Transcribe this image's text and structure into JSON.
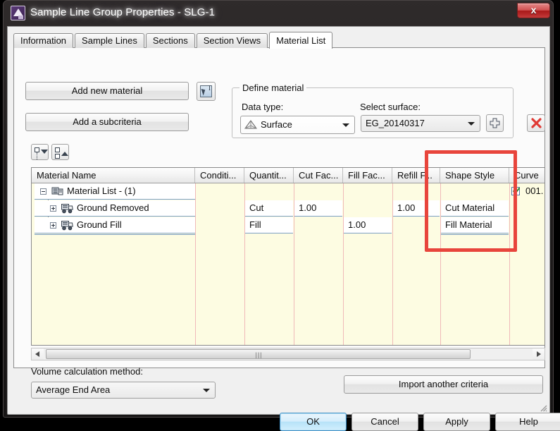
{
  "window": {
    "title": "Sample Line Group Properties - SLG-1",
    "app_icon": "civil3d-app-icon",
    "close_label": "x"
  },
  "tabs": [
    {
      "label": "Information",
      "active": false
    },
    {
      "label": "Sample Lines",
      "active": false
    },
    {
      "label": "Sections",
      "active": false
    },
    {
      "label": "Section Views",
      "active": false
    },
    {
      "label": "Material List",
      "active": true
    }
  ],
  "toolbar": {
    "add_new_material": "Add new material",
    "add_a_subcriteria": "Add a subcriteria",
    "pick_icon": "pick-on-screen-icon",
    "tree_expand_icon": "expand-all-icon",
    "tree_collapse_icon": "collapse-all-icon"
  },
  "define_material": {
    "legend": "Define material",
    "data_type_label": "Data type:",
    "data_type_value": "Surface",
    "data_type_icon": "surface-icon",
    "select_surface_label": "Select surface:",
    "select_surface_value": "EG_20140317",
    "add_icon": "plus-icon",
    "delete_icon": "red-x-icon"
  },
  "grid": {
    "columns": [
      "Material Name",
      "Conditi...",
      "Quantit...",
      "Cut Fac...",
      "Fill Fac...",
      "Refill F...",
      "Shape Style",
      "Curve"
    ],
    "rows": [
      {
        "name": "Material List - (1)",
        "indent": 0,
        "toggle": "minus",
        "icon": "material-list-icon",
        "condition": "",
        "quantity": "",
        "cut_factor": "",
        "fill_factor": "",
        "refill_factor": "",
        "shape_style": "",
        "curve_checked": true,
        "curve": "001."
      },
      {
        "name": "Ground Removed",
        "indent": 1,
        "toggle": "plus",
        "icon": "material-truck-icon",
        "condition": "",
        "quantity": "Cut",
        "cut_factor": "1.00",
        "fill_factor": "",
        "refill_factor": "1.00",
        "shape_style": "Cut Material",
        "curve_checked": false,
        "curve": ""
      },
      {
        "name": "Ground Fill",
        "indent": 1,
        "toggle": "plus",
        "icon": "material-truck-icon",
        "condition": "",
        "quantity": "Fill",
        "cut_factor": "",
        "fill_factor": "1.00",
        "refill_factor": "",
        "shape_style": "Fill Material",
        "curve_checked": false,
        "curve": ""
      }
    ],
    "scroll_grip": "|||"
  },
  "bottom": {
    "volume_method_label": "Volume calculation method:",
    "volume_method_value": "Average End Area",
    "import_criteria": "Import another criteria"
  },
  "footer": {
    "ok": "OK",
    "cancel": "Cancel",
    "apply": "Apply",
    "help": "Help"
  },
  "annotation": {
    "highlight_color": "#e8453c"
  },
  "colors": {
    "grid_background": "#fdfce2",
    "cell_background": "#ffffff",
    "column_divider": "#f0b9b9",
    "row_underline": "#7da0c4",
    "accent_blue": "#3c8ec4"
  }
}
